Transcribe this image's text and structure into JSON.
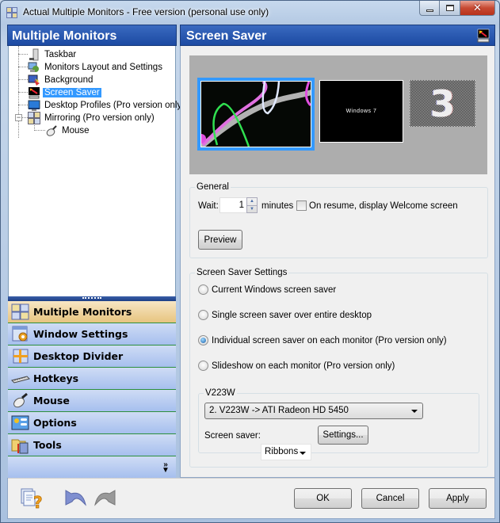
{
  "window": {
    "title": "Actual Multiple Monitors - Free version (personal use only)",
    "app_icon": "app-grid-icon",
    "caption_buttons": [
      "minimize",
      "maximize",
      "close"
    ]
  },
  "left_panel": {
    "header": "Multiple Monitors",
    "tree": [
      {
        "label": "Taskbar",
        "icon": "taskbar-icon",
        "selected": false
      },
      {
        "label": "Monitors Layout and Settings",
        "icon": "monitors-layout-icon",
        "selected": false
      },
      {
        "label": "Background",
        "icon": "background-icon",
        "selected": false
      },
      {
        "label": "Screen Saver",
        "icon": "screen-saver-icon",
        "selected": true
      },
      {
        "label": "Desktop Profiles (Pro version only)",
        "icon": "desktop-profiles-icon",
        "selected": false
      },
      {
        "label": "Mirroring (Pro version only)",
        "icon": "mirroring-icon",
        "selected": false,
        "expanded": true,
        "children": [
          {
            "label": "Mouse",
            "icon": "mouse-icon"
          }
        ]
      }
    ],
    "nav": [
      {
        "label": "Multiple Monitors",
        "icon": "multiple-monitors-icon",
        "active": true
      },
      {
        "label": "Window Settings",
        "icon": "window-settings-icon",
        "active": false
      },
      {
        "label": "Desktop Divider",
        "icon": "desktop-divider-icon",
        "active": false
      },
      {
        "label": "Hotkeys",
        "icon": "keyboard-icon",
        "active": false
      },
      {
        "label": "Mouse",
        "icon": "mouse-icon",
        "active": false
      },
      {
        "label": "Options",
        "icon": "options-icon",
        "active": false
      },
      {
        "label": "Tools",
        "icon": "tools-icon",
        "active": false
      }
    ],
    "more_icon": "chevron-double-down-icon"
  },
  "right_panel": {
    "header": "Screen Saver",
    "header_icon": "screen-saver-icon",
    "preview": {
      "monitors": [
        {
          "id": 1,
          "content": "Ribbons screen saver",
          "selected": true
        },
        {
          "id": 2,
          "content": "Windows 7"
        },
        {
          "id": 3,
          "content": "3"
        }
      ]
    },
    "general": {
      "legend": "General",
      "wait_label": "Wait:",
      "wait_value": "1",
      "minutes_label": "minutes",
      "welcome_checkbox_label": "On resume, display Welcome screen",
      "welcome_checked": false,
      "preview_button": "Preview"
    },
    "screen_saver_settings": {
      "legend": "Screen Saver Settings",
      "options": [
        {
          "label": "Current Windows screen saver",
          "checked": false
        },
        {
          "label": "Single screen saver over entire desktop",
          "checked": false
        },
        {
          "label": "Individual screen saver on each monitor (Pro version only)",
          "checked": true
        },
        {
          "label": "Slideshow on each monitor (Pro version only)",
          "checked": false
        }
      ],
      "monitor_group": {
        "legend": "V223W",
        "monitor_select": "2. V223W -> ATI Radeon HD 5450",
        "screen_saver_label": "Screen saver:",
        "screen_saver_select": "Ribbons",
        "settings_button": "Settings..."
      }
    }
  },
  "footer": {
    "help_icon": "help-icon",
    "undo_icon": "undo-icon",
    "redo_icon": "redo-icon",
    "ok": "OK",
    "cancel": "Cancel",
    "apply": "Apply"
  }
}
